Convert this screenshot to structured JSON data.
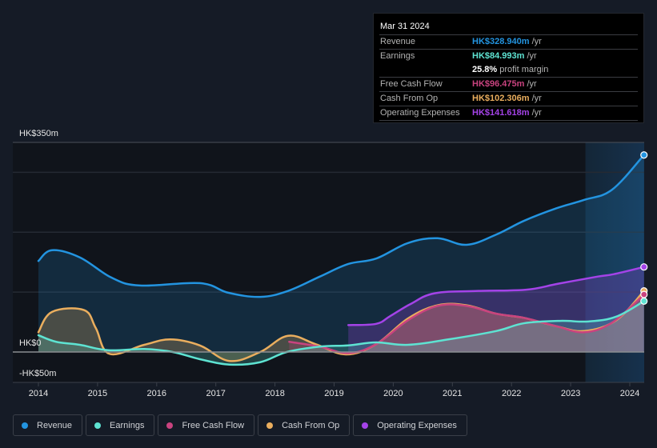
{
  "tooltip": {
    "date": "Mar 31 2024",
    "rows": [
      {
        "label": "Revenue",
        "value": "HK$328.940m",
        "unit": "/yr",
        "color": "#2394e0"
      },
      {
        "label": "Earnings",
        "value": "HK$84.993m",
        "unit": "/yr",
        "color": "#5ee3d2"
      },
      {
        "label": "",
        "value": "25.8%",
        "unit": "profit margin",
        "color": "#ffffff"
      },
      {
        "label": "Free Cash Flow",
        "value": "HK$96.475m",
        "unit": "/yr",
        "color": "#c9437f"
      },
      {
        "label": "Cash From Op",
        "value": "HK$102.306m",
        "unit": "/yr",
        "color": "#eaae5e"
      },
      {
        "label": "Operating Expenses",
        "value": "HK$141.618m",
        "unit": "/yr",
        "color": "#a443e8"
      }
    ]
  },
  "legend": [
    {
      "label": "Revenue",
      "color": "#2394e0"
    },
    {
      "label": "Earnings",
      "color": "#5ee3d2"
    },
    {
      "label": "Free Cash Flow",
      "color": "#c9437f"
    },
    {
      "label": "Cash From Op",
      "color": "#eaae5e"
    },
    {
      "label": "Operating Expenses",
      "color": "#a443e8"
    }
  ],
  "chart_data": {
    "type": "area",
    "title": "",
    "xlabel": "",
    "ylabel": "",
    "currency": "HK$",
    "y_tick_labels": [
      "HK$350m",
      "HK$0",
      "-HK$50m"
    ],
    "y_ticks": [
      350,
      0,
      -50
    ],
    "gridlines_at": [
      300,
      200,
      100
    ],
    "ylim": [
      -50,
      350
    ],
    "xlim": [
      2013.55,
      2024.25
    ],
    "x_tick_labels": [
      "2014",
      "2015",
      "2016",
      "2017",
      "2018",
      "2019",
      "2020",
      "2021",
      "2022",
      "2023",
      "2024"
    ],
    "x_ticks": [
      2014,
      2015,
      2016,
      2017,
      2018,
      2019,
      2020,
      2021,
      2022,
      2023,
      2024
    ],
    "highlight_range": [
      2023.25,
      2024.25
    ],
    "grid": true,
    "legend_position": "bottom-left",
    "series": [
      {
        "name": "Revenue",
        "color": "#2394e0",
        "x": [
          2014.0,
          2014.23,
          2014.7,
          2015.24,
          2015.72,
          2016.73,
          2017.21,
          2017.75,
          2018.22,
          2018.76,
          2019.24,
          2019.71,
          2020.25,
          2020.75,
          2021.24,
          2021.74,
          2022.21,
          2022.76,
          2023.23,
          2023.7,
          2024.24
        ],
        "values": [
          152,
          170,
          158,
          124,
          111,
          115,
          99,
          92,
          102,
          126,
          147,
          156,
          182,
          190,
          179,
          196,
          219,
          240,
          254,
          271,
          329
        ]
      },
      {
        "name": "Earnings",
        "color": "#5ee3d2",
        "x": [
          2014.0,
          2014.3,
          2014.7,
          2015.18,
          2015.79,
          2016.27,
          2016.73,
          2017.23,
          2017.75,
          2018.2,
          2018.76,
          2019.24,
          2019.71,
          2020.25,
          2020.93,
          2021.74,
          2022.21,
          2022.82,
          2023.3,
          2023.77,
          2024.24
        ],
        "values": [
          28,
          17,
          12,
          3,
          5,
          0,
          -12,
          -21,
          -17,
          0,
          9,
          11,
          16,
          12,
          21,
          35,
          48,
          52,
          51,
          59,
          85
        ]
      },
      {
        "name": "Free Cash Flow",
        "color": "#c9437f",
        "x": [
          2018.24,
          2018.76,
          2019.24,
          2019.71,
          2020.25,
          2020.75,
          2021.24,
          2021.74,
          2022.21,
          2022.76,
          2023.23,
          2023.7,
          2024.24
        ],
        "values": [
          17,
          9,
          -2,
          13,
          53,
          77,
          77,
          64,
          57,
          43,
          33,
          49,
          96
        ]
      },
      {
        "name": "Cash From Op",
        "color": "#eaae5e",
        "x": [
          2014.0,
          2014.23,
          2014.77,
          2014.97,
          2015.2,
          2015.79,
          2016.23,
          2016.73,
          2017.23,
          2017.75,
          2018.22,
          2018.69,
          2019.2,
          2019.71,
          2020.25,
          2020.75,
          2021.24,
          2021.74,
          2022.21,
          2022.76,
          2023.23,
          2023.77,
          2024.24
        ],
        "values": [
          33,
          67,
          70,
          40,
          -3,
          12,
          21,
          11,
          -15,
          0,
          27,
          13,
          -4,
          13,
          56,
          78,
          78,
          64,
          57,
          43,
          35,
          53,
          102
        ]
      },
      {
        "name": "Operating Expenses",
        "color": "#a443e8",
        "x": [
          2019.24,
          2019.71,
          2019.95,
          2020.29,
          2020.7,
          2021.44,
          2022.25,
          2022.79,
          2023.46,
          2023.73,
          2024.24
        ],
        "values": [
          45,
          47,
          60,
          80,
          98,
          102,
          104,
          114,
          126,
          130,
          142
        ]
      }
    ],
    "end_markers": {
      "x": 2024.24,
      "series": [
        "Revenue",
        "Operating Expenses",
        "Cash From Op",
        "Free Cash Flow",
        "Earnings"
      ]
    }
  }
}
